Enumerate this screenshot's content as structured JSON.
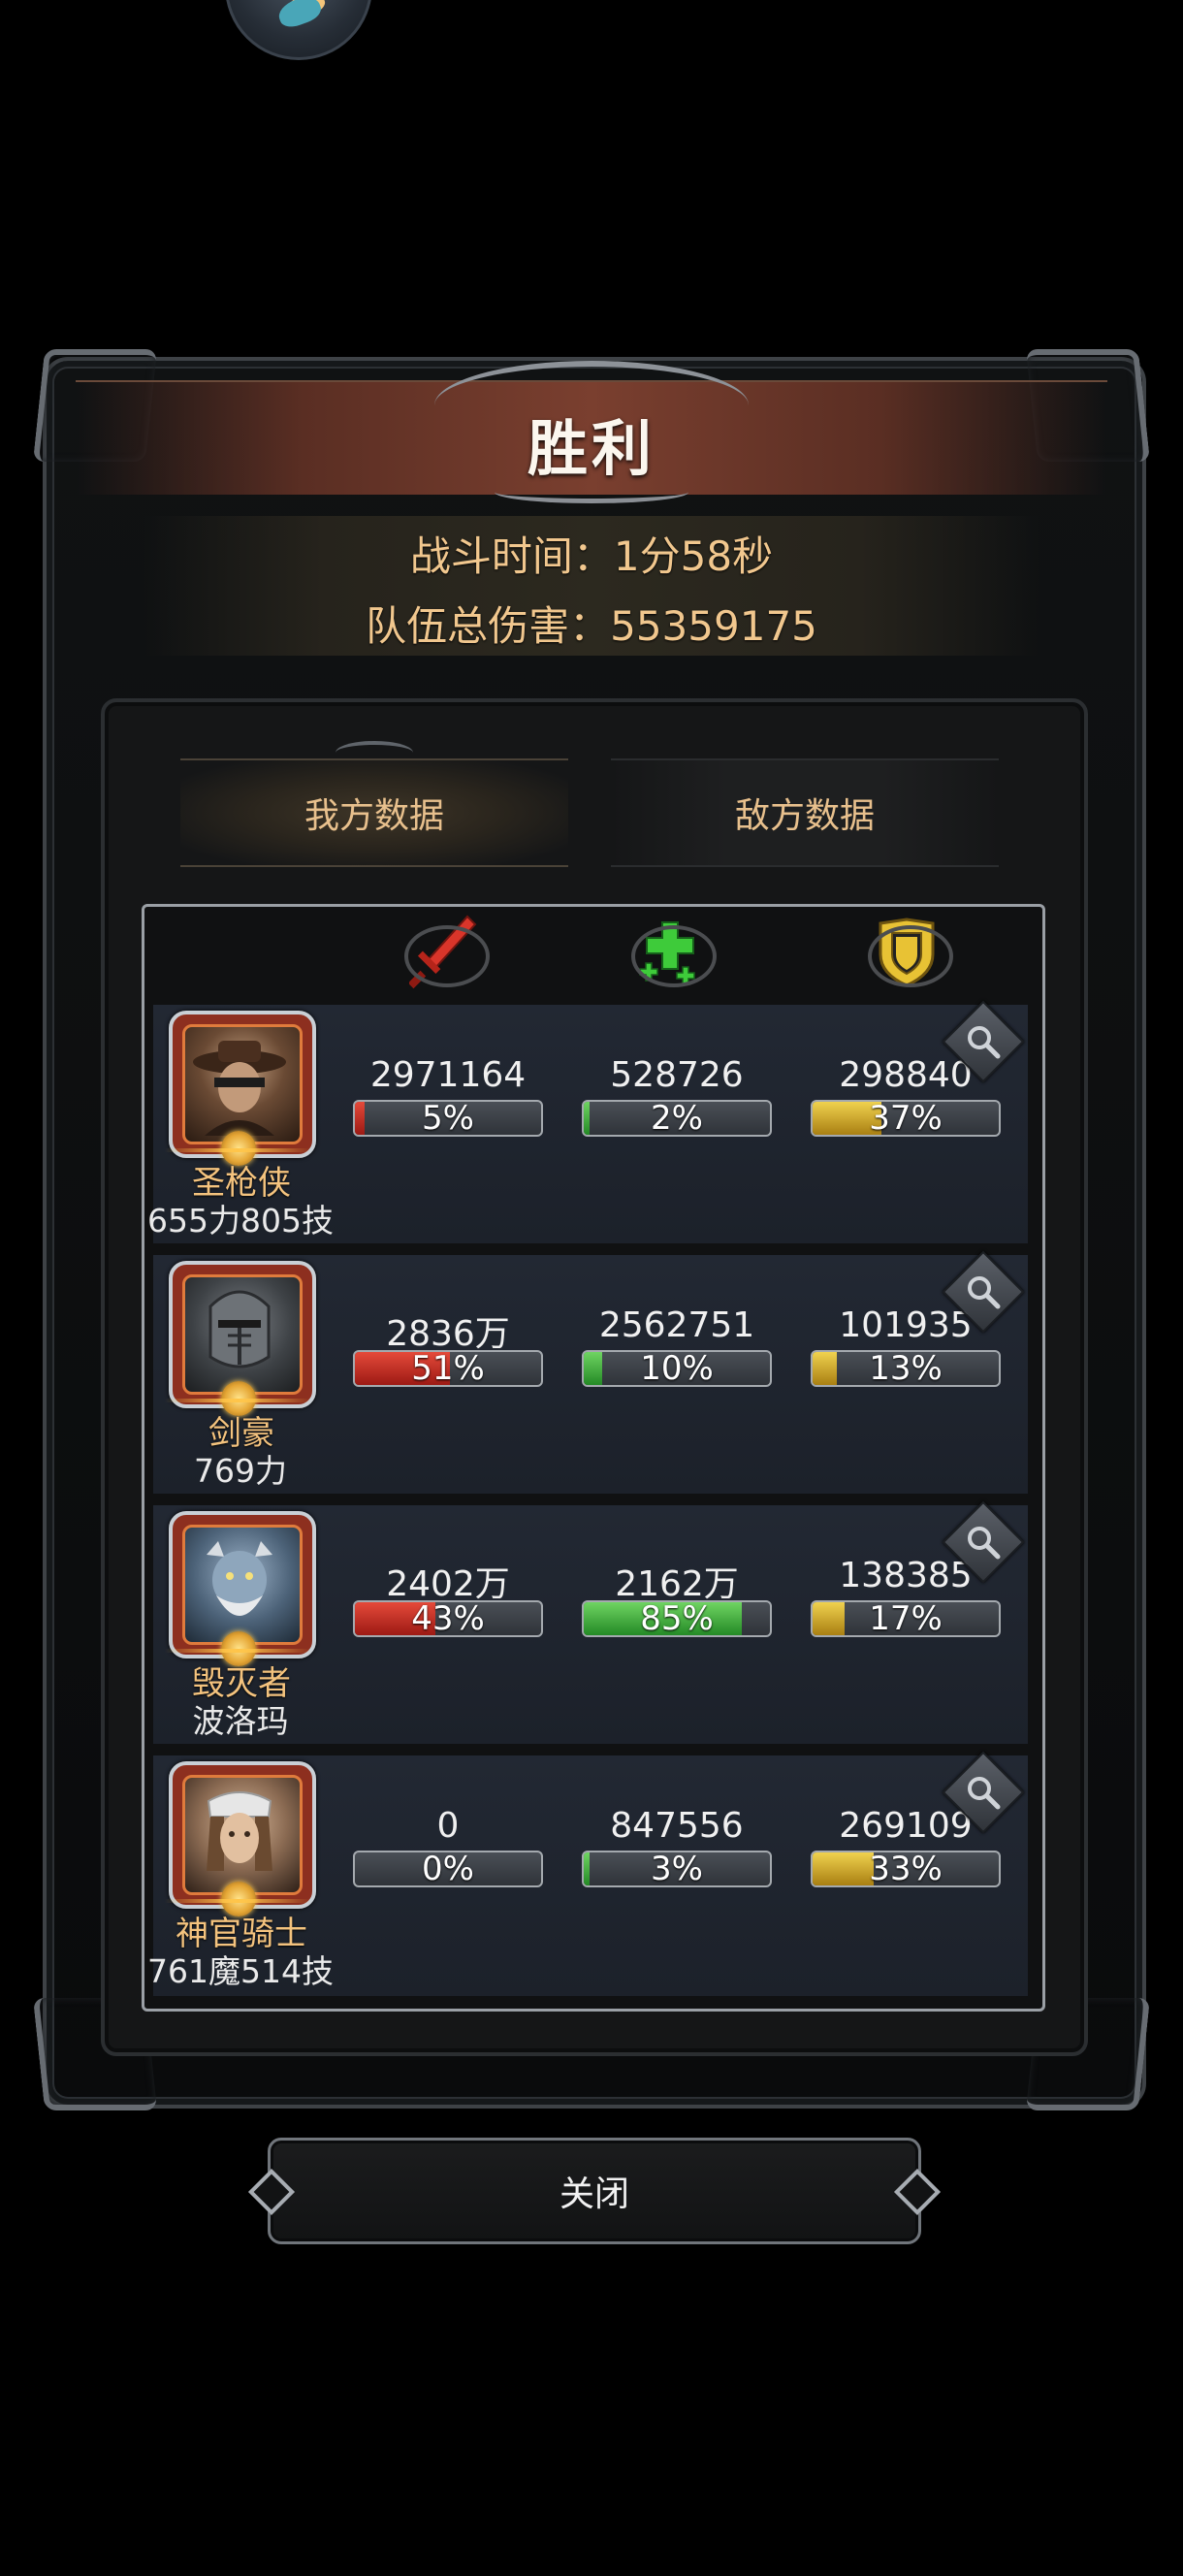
{
  "title": "胜利",
  "summary": {
    "battle_time": "战斗时间：1分58秒",
    "total_damage": "队伍总伤害：55359175"
  },
  "tabs": {
    "ours": "我方数据",
    "enemy": "敌方数据"
  },
  "columns": {
    "damage_icon": "sword-icon",
    "heal_icon": "heal-cross-icon",
    "defense_icon": "shield-icon"
  },
  "colors": {
    "damage": "#c62b20",
    "heal": "#3fb23b",
    "defense": "#d8ab2c",
    "accent_text": "#f1c78e"
  },
  "heroes": [
    {
      "name": "圣枪侠",
      "sub": "655力805技",
      "portrait_color": "#5a3a28",
      "damage": "2971164",
      "damage_pct_text": "5%",
      "damage_pct": 5,
      "heal": "528726",
      "heal_pct_text": "2%",
      "heal_pct": 2,
      "defense": "298840",
      "defense_pct_text": "37%",
      "defense_pct": 37
    },
    {
      "name": "剑豪",
      "sub": "769力",
      "portrait_color": "#4a4f55",
      "damage": "2836万",
      "damage_pct_text": "51%",
      "damage_pct": 51,
      "heal": "2562751",
      "heal_pct_text": "10%",
      "heal_pct": 10,
      "defense": "101935",
      "defense_pct_text": "13%",
      "defense_pct": 13
    },
    {
      "name": "毁灭者",
      "sub": "波洛玛",
      "portrait_color": "#5b7288",
      "damage": "2402万",
      "damage_pct_text": "43%",
      "damage_pct": 43,
      "heal": "2162万",
      "heal_pct_text": "85%",
      "heal_pct": 85,
      "defense": "138385",
      "defense_pct_text": "17%",
      "defense_pct": 17
    },
    {
      "name": "神官骑士",
      "sub": "761魔514技",
      "portrait_color": "#8a6a52",
      "damage": "0",
      "damage_pct_text": "0%",
      "damage_pct": 0,
      "heal": "847556",
      "heal_pct_text": "3%",
      "heal_pct": 3,
      "defense": "269109",
      "defense_pct_text": "33%",
      "defense_pct": 33
    }
  ],
  "close_label": "关闭"
}
